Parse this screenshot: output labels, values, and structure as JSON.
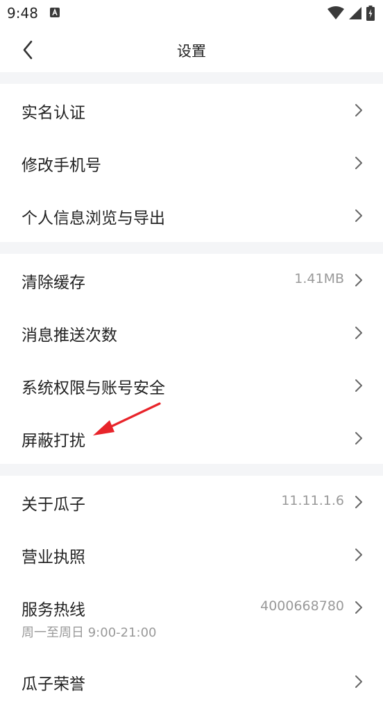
{
  "status_bar": {
    "time": "9:48"
  },
  "header": {
    "title": "设置"
  },
  "groups": [
    {
      "items": [
        {
          "label": "实名认证"
        },
        {
          "label": "修改手机号"
        },
        {
          "label": "个人信息浏览与导出"
        }
      ]
    },
    {
      "items": [
        {
          "label": "清除缓存",
          "value": "1.41MB"
        },
        {
          "label": "消息推送次数"
        },
        {
          "label": "系统权限与账号安全"
        },
        {
          "label": "屏蔽打扰"
        }
      ]
    },
    {
      "items": [
        {
          "label": "关于瓜子",
          "value": "11.11.1.6"
        },
        {
          "label": "营业执照"
        },
        {
          "label": "服务热线",
          "value": "4000668780",
          "sub": "周一至周日 9:00-21:00"
        },
        {
          "label": "瓜子荣誉"
        }
      ]
    }
  ],
  "colors": {
    "annotation_arrow": "#e8242a",
    "section_gap": "#f4f5f7",
    "secondary_text": "#999999"
  },
  "icons": [
    "back-arrow-icon",
    "chevron-right-icon",
    "wifi-icon",
    "cellular-signal-icon",
    "battery-icon",
    "notification-app-icon"
  ]
}
